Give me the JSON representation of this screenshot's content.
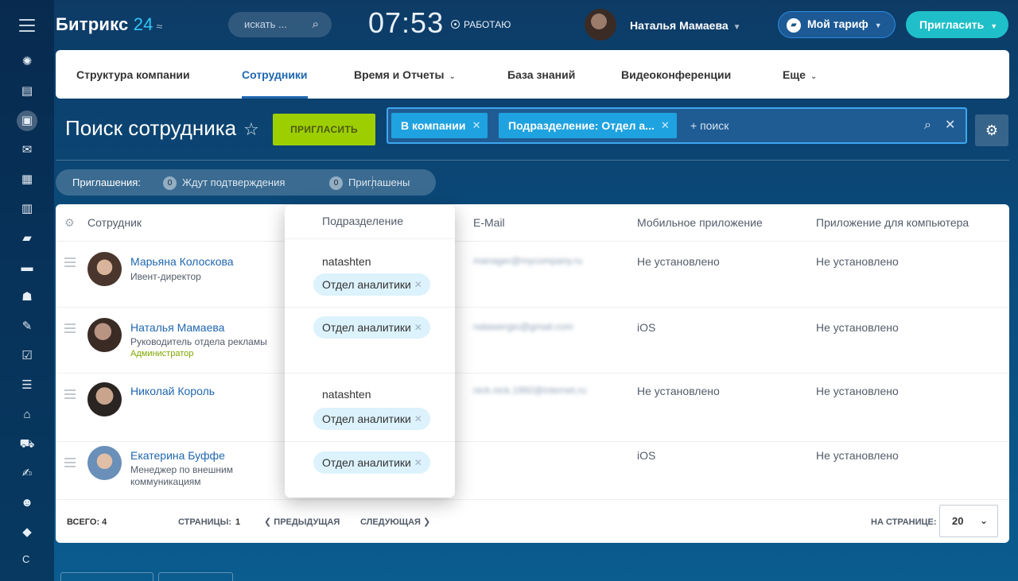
{
  "header": {
    "logo_main": "Битрикс",
    "logo_num": "24",
    "search_placeholder": "искать ...",
    "clock": "07:53",
    "work_status": "РАБОТАЮ",
    "user_name": "Наталья Мамаева",
    "tariff_label": "Мой тариф",
    "invite_label": "Пригласить"
  },
  "tabs": [
    {
      "label": "Структура компании"
    },
    {
      "label": "Сотрудники"
    },
    {
      "label": "Время и Отчеты"
    },
    {
      "label": "База знаний"
    },
    {
      "label": "Видеоконференции"
    },
    {
      "label": "Еще"
    }
  ],
  "page": {
    "title": "Поиск сотрудника",
    "invite_button": "ПРИГЛАСИТЬ"
  },
  "filter": {
    "chips": [
      {
        "label": "В компании"
      },
      {
        "label": "Подразделение: Отдел а..."
      }
    ],
    "placeholder": "+ поиск"
  },
  "invites": {
    "label": "Приглашения:",
    "awaiting_count": "0",
    "awaiting_label": "Ждут подтверждения",
    "invited_count": "0",
    "invited_label": "Приглашены"
  },
  "grid": {
    "columns": {
      "employee": "Сотрудник",
      "email": "E-Mail",
      "mobile": "Мобильное приложение",
      "desktop": "Приложение для компьютера"
    },
    "rows": [
      {
        "name": "Марьяна Колоскова",
        "position": "Ивент-директор",
        "role": "",
        "email": "manager@mycompany.ru",
        "mobile": "Не установлено",
        "desktop": "Не установлено"
      },
      {
        "name": "Наталья Мамаева",
        "position": "Руководитель отдела рекламы",
        "role": "Администратор",
        "email": "natawergio@gmail.com",
        "mobile": "iOS",
        "desktop": "Не установлено"
      },
      {
        "name": "Николай Король",
        "position": "",
        "role": "",
        "email": "nick.nick.1992@internet.ru",
        "mobile": "Не установлено",
        "desktop": "Не установлено"
      },
      {
        "name": "Екатерина Буффе",
        "position": "Менеджер по внешним коммуникациям",
        "role": "",
        "email": "",
        "mobile": "iOS",
        "desktop": "Не установлено"
      }
    ],
    "footer": {
      "total_label": "ВСЕГО: 4",
      "pages_label": "СТРАНИЦЫ:",
      "pages_value": "1",
      "prev": "ПРЕДЫДУЩАЯ",
      "next": "СЛЕДУЮЩАЯ",
      "per_page_label": "НА СТРАНИЦЕ:",
      "per_page_value": "20"
    }
  },
  "popup": {
    "header": "Подразделение",
    "cells": [
      {
        "user": "natashten",
        "dept": "Отдел аналитики"
      },
      {
        "user": "",
        "dept": "Отдел аналитики"
      },
      {
        "user": "natashten",
        "dept": "Отдел аналитики"
      },
      {
        "user": "",
        "dept": "Отдел аналитики"
      }
    ]
  },
  "rail": {
    "bottom_letter": "C"
  },
  "colors": {
    "accent_blue": "#2067b0",
    "invite_green": "#9dcf00",
    "filter_chip": "#1fa2e0",
    "invite_teal": "#1fbfc9"
  }
}
